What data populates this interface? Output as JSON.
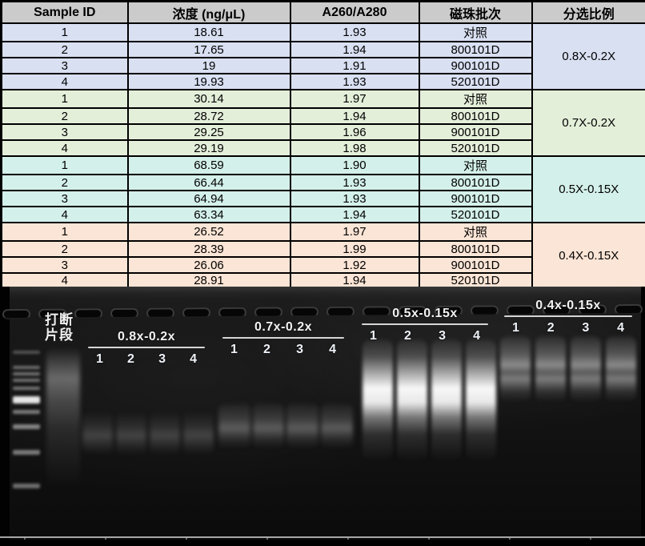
{
  "table": {
    "headers": [
      "Sample ID",
      "浓度 (ng/μL)",
      "A260/A280",
      "磁珠批次",
      "分选比例"
    ],
    "groups": [
      {
        "ratio": "0.8X-0.2X",
        "color": "#D9E0F2",
        "rows": [
          {
            "id": "1",
            "conc": "18.61",
            "a260_a280": "1.93",
            "batch": "对照"
          },
          {
            "id": "2",
            "conc": "17.65",
            "a260_a280": "1.94",
            "batch": "800101D"
          },
          {
            "id": "3",
            "conc": "19",
            "a260_a280": "1.91",
            "batch": "900101D"
          },
          {
            "id": "4",
            "conc": "19.93",
            "a260_a280": "1.93",
            "batch": "520101D"
          }
        ]
      },
      {
        "ratio": "0.7X-0.2X",
        "color": "#E4EFDA",
        "rows": [
          {
            "id": "1",
            "conc": "30.14",
            "a260_a280": "1.97",
            "batch": "对照"
          },
          {
            "id": "2",
            "conc": "28.72",
            "a260_a280": "1.94",
            "batch": "800101D"
          },
          {
            "id": "3",
            "conc": "29.25",
            "a260_a280": "1.96",
            "batch": "900101D"
          },
          {
            "id": "4",
            "conc": "29.19",
            "a260_a280": "1.98",
            "batch": "520101D"
          }
        ]
      },
      {
        "ratio": "0.5X-0.15X",
        "color": "#D4F0EA",
        "rows": [
          {
            "id": "1",
            "conc": "68.59",
            "a260_a280": "1.90",
            "batch": "对照"
          },
          {
            "id": "2",
            "conc": "66.44",
            "a260_a280": "1.93",
            "batch": "800101D"
          },
          {
            "id": "3",
            "conc": "64.94",
            "a260_a280": "1.93",
            "batch": "900101D"
          },
          {
            "id": "4",
            "conc": "63.34",
            "a260_a280": "1.94",
            "batch": "520101D"
          }
        ]
      },
      {
        "ratio": "0.4X-0.15X",
        "color": "#FBE5D6",
        "rows": [
          {
            "id": "1",
            "conc": "26.52",
            "a260_a280": "1.97",
            "batch": "对照"
          },
          {
            "id": "2",
            "conc": "28.39",
            "a260_a280": "1.99",
            "batch": "800101D"
          },
          {
            "id": "3",
            "conc": "26.06",
            "a260_a280": "1.92",
            "batch": "900101D"
          },
          {
            "id": "4",
            "conc": "28.91",
            "a260_a280": "1.94",
            "batch": "520101D"
          }
        ]
      }
    ],
    "header_bg": "#CBCBCB"
  },
  "gel": {
    "marker_label_line1": "打断",
    "marker_label_line2": "片段",
    "groups": [
      {
        "label": "0.8x-0.2x",
        "lanes": [
          "1",
          "2",
          "3",
          "4"
        ]
      },
      {
        "label": "0.7x-0.2x",
        "lanes": [
          "1",
          "2",
          "3",
          "4"
        ]
      },
      {
        "label": "0.5x-0.15x",
        "lanes": [
          "1",
          "2",
          "3",
          "4"
        ]
      },
      {
        "label": "0.4x-0.15x",
        "lanes": [
          "1",
          "2",
          "3",
          "4"
        ]
      }
    ]
  }
}
